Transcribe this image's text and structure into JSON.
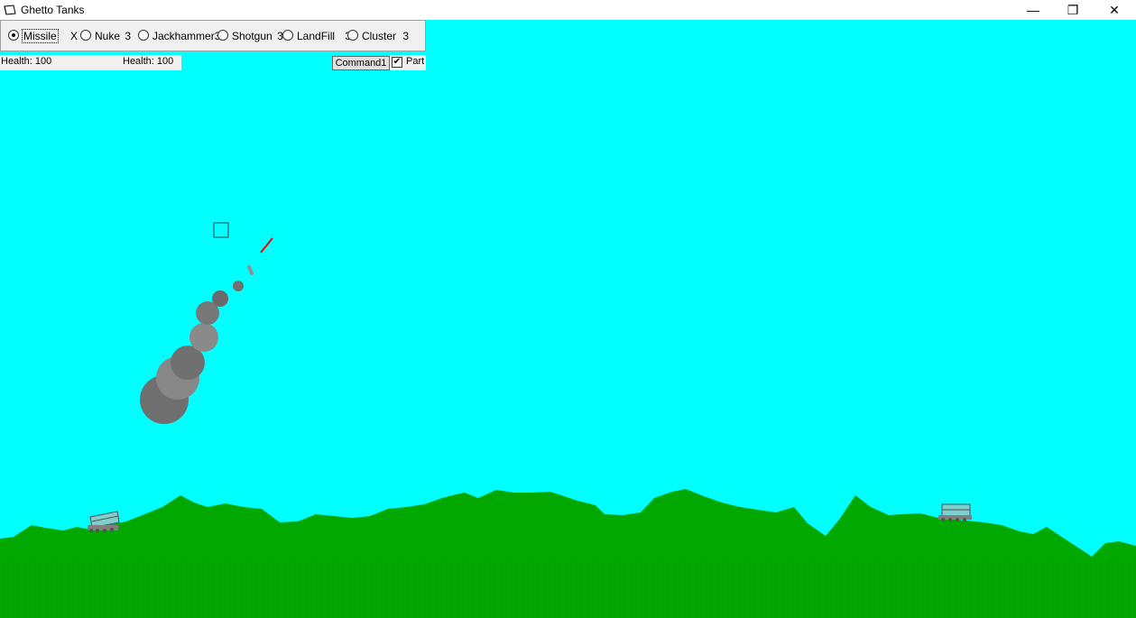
{
  "window": {
    "title": "Ghetto Tanks",
    "icon": "app-icon",
    "controls": {
      "minimize": "—",
      "maximize": "❐",
      "close": "✕"
    }
  },
  "weapons": [
    {
      "label": "Missile",
      "count": "X",
      "selected": true
    },
    {
      "label": "Nuke",
      "count": "3",
      "selected": false
    },
    {
      "label": "Jackhammer",
      "count": "3",
      "selected": false
    },
    {
      "label": "Shotgun",
      "count": "3",
      "selected": false
    },
    {
      "label": "LandFill",
      "count": "3",
      "selected": false
    },
    {
      "label": "Cluster",
      "count": "3",
      "selected": false
    }
  ],
  "players": [
    {
      "health_label": "Health: 100"
    },
    {
      "health_label": "Health: 100"
    }
  ],
  "command_button": "Command1",
  "part_checkbox": {
    "label": "Part",
    "checked": true,
    "mark": "✔"
  },
  "colors": {
    "sky": "#00ffff",
    "terrain": "#00a800",
    "smoke": "#808080",
    "projectile": "#ff0000"
  }
}
